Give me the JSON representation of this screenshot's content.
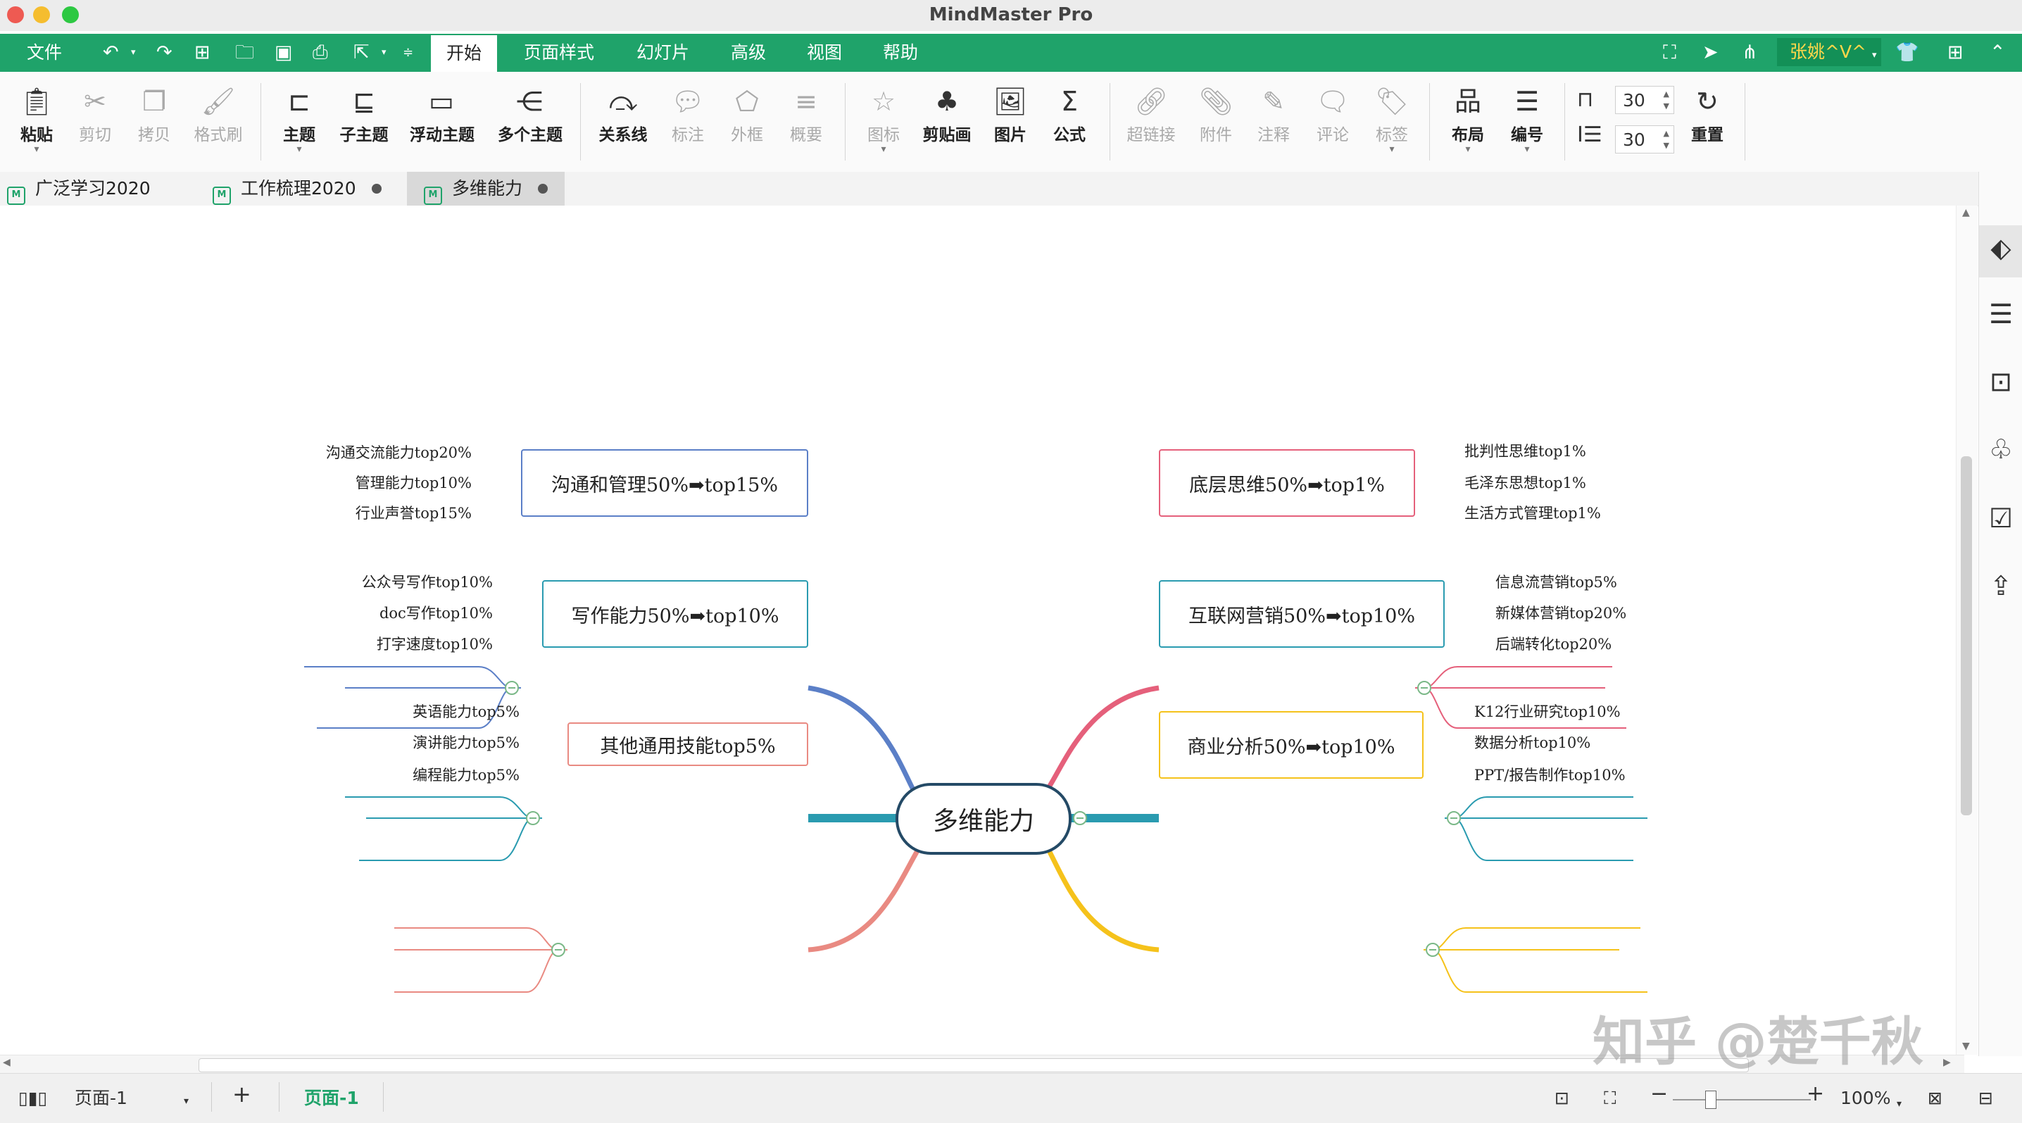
{
  "window": {
    "title": "MindMaster Pro"
  },
  "menubar": {
    "file": "文件",
    "tabs": [
      "开始",
      "页面样式",
      "幻灯片",
      "高级",
      "视图",
      "帮助"
    ],
    "user": "张姚^V^"
  },
  "ribbon": {
    "tools": [
      {
        "label": "粘贴",
        "icon": "paste-icon",
        "enabled": true
      },
      {
        "label": "剪切",
        "icon": "scissors-icon",
        "enabled": false
      },
      {
        "label": "拷贝",
        "icon": "copy-icon",
        "enabled": false
      },
      {
        "label": "格式刷",
        "icon": "format-painter-icon",
        "enabled": false
      },
      {
        "label": "主题",
        "icon": "topic-icon",
        "enabled": true
      },
      {
        "label": "子主题",
        "icon": "subtopic-icon",
        "enabled": true
      },
      {
        "label": "浮动主题",
        "icon": "floating-topic-icon",
        "enabled": true
      },
      {
        "label": "多个主题",
        "icon": "multiple-topics-icon",
        "enabled": true
      },
      {
        "label": "关系线",
        "icon": "relationship-icon",
        "enabled": true
      },
      {
        "label": "标注",
        "icon": "callout-icon",
        "enabled": false
      },
      {
        "label": "外框",
        "icon": "boundary-icon",
        "enabled": false
      },
      {
        "label": "概要",
        "icon": "summary-icon",
        "enabled": false
      },
      {
        "label": "图标",
        "icon": "mark-icon",
        "enabled": false
      },
      {
        "label": "剪贴画",
        "icon": "clipart-icon",
        "enabled": true
      },
      {
        "label": "图片",
        "icon": "image-icon",
        "enabled": true
      },
      {
        "label": "公式",
        "icon": "formula-icon",
        "enabled": true
      },
      {
        "label": "超链接",
        "icon": "hyperlink-icon",
        "enabled": false
      },
      {
        "label": "附件",
        "icon": "attachment-icon",
        "enabled": false
      },
      {
        "label": "注释",
        "icon": "note-icon",
        "enabled": false
      },
      {
        "label": "评论",
        "icon": "comment-icon",
        "enabled": false
      },
      {
        "label": "标签",
        "icon": "tag-icon",
        "enabled": false
      },
      {
        "label": "布局",
        "icon": "layout-icon",
        "enabled": true
      },
      {
        "label": "编号",
        "icon": "numbering-icon",
        "enabled": true
      },
      {
        "label": "重置",
        "icon": "reset-icon",
        "enabled": true
      }
    ],
    "spacing_h": "30",
    "spacing_v": "30"
  },
  "doc_tabs": [
    {
      "label": "广泛学习2020",
      "modified": false
    },
    {
      "label": "工作梳理2020",
      "modified": true
    },
    {
      "label": "多维能力",
      "modified": true
    }
  ],
  "mindmap": {
    "central": "多维能力",
    "branches": [
      {
        "title": "沟通和管理50%➡top15%",
        "color": "#5b7fc7",
        "side": "left",
        "children": [
          "沟通交流能力top20%",
          "管理能力top10%",
          "行业声誉top15%"
        ]
      },
      {
        "title": "写作能力50%➡top10%",
        "color": "#2a9bb0",
        "side": "left",
        "children": [
          "公众号写作top10%",
          "doc写作top10%",
          "打字速度top10%"
        ]
      },
      {
        "title": "其他通用技能top5%",
        "color": "#e98a82",
        "side": "left",
        "children": [
          "英语能力top5%",
          "演讲能力top5%",
          "编程能力top5%"
        ]
      },
      {
        "title": "底层思维50%➡top1%",
        "color": "#e5607b",
        "side": "right",
        "children": [
          "批判性思维top1%",
          "毛泽东思想top1%",
          "生活方式管理top1%"
        ]
      },
      {
        "title": "互联网营销50%➡top10%",
        "color": "#2a9bb0",
        "side": "right",
        "children": [
          "信息流营销top5%",
          "新媒体营销top20%",
          "后端转化top20%"
        ]
      },
      {
        "title": "商业分析50%➡top10%",
        "color": "#f5c21b",
        "side": "right",
        "children": [
          "K12行业研究top10%",
          "数据分析top10%",
          "PPT/报告制作top10%"
        ]
      }
    ]
  },
  "statusbar": {
    "page_select": "页面-1",
    "page_tab": "页面-1",
    "zoom": "100%"
  },
  "watermark": "知乎 @楚千秋"
}
